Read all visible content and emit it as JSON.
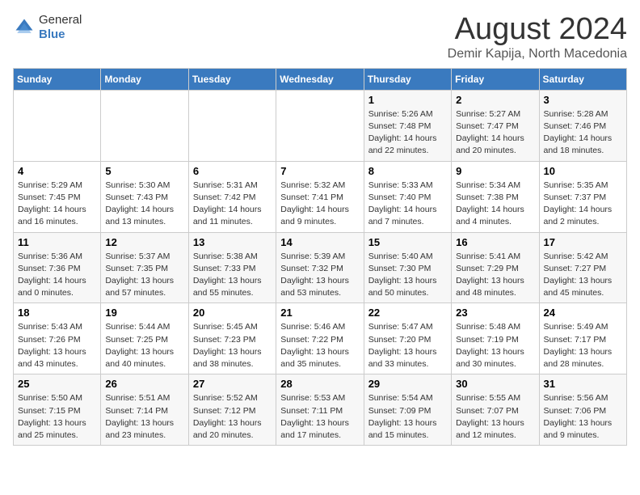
{
  "header": {
    "logo_general": "General",
    "logo_blue": "Blue",
    "title": "August 2024",
    "subtitle": "Demir Kapija, North Macedonia"
  },
  "weekdays": [
    "Sunday",
    "Monday",
    "Tuesday",
    "Wednesday",
    "Thursday",
    "Friday",
    "Saturday"
  ],
  "weeks": [
    [
      {
        "day": "",
        "sunrise": "",
        "sunset": "",
        "daylight": ""
      },
      {
        "day": "",
        "sunrise": "",
        "sunset": "",
        "daylight": ""
      },
      {
        "day": "",
        "sunrise": "",
        "sunset": "",
        "daylight": ""
      },
      {
        "day": "",
        "sunrise": "",
        "sunset": "",
        "daylight": ""
      },
      {
        "day": "1",
        "sunrise": "Sunrise: 5:26 AM",
        "sunset": "Sunset: 7:48 PM",
        "daylight": "Daylight: 14 hours and 22 minutes."
      },
      {
        "day": "2",
        "sunrise": "Sunrise: 5:27 AM",
        "sunset": "Sunset: 7:47 PM",
        "daylight": "Daylight: 14 hours and 20 minutes."
      },
      {
        "day": "3",
        "sunrise": "Sunrise: 5:28 AM",
        "sunset": "Sunset: 7:46 PM",
        "daylight": "Daylight: 14 hours and 18 minutes."
      }
    ],
    [
      {
        "day": "4",
        "sunrise": "Sunrise: 5:29 AM",
        "sunset": "Sunset: 7:45 PM",
        "daylight": "Daylight: 14 hours and 16 minutes."
      },
      {
        "day": "5",
        "sunrise": "Sunrise: 5:30 AM",
        "sunset": "Sunset: 7:43 PM",
        "daylight": "Daylight: 14 hours and 13 minutes."
      },
      {
        "day": "6",
        "sunrise": "Sunrise: 5:31 AM",
        "sunset": "Sunset: 7:42 PM",
        "daylight": "Daylight: 14 hours and 11 minutes."
      },
      {
        "day": "7",
        "sunrise": "Sunrise: 5:32 AM",
        "sunset": "Sunset: 7:41 PM",
        "daylight": "Daylight: 14 hours and 9 minutes."
      },
      {
        "day": "8",
        "sunrise": "Sunrise: 5:33 AM",
        "sunset": "Sunset: 7:40 PM",
        "daylight": "Daylight: 14 hours and 7 minutes."
      },
      {
        "day": "9",
        "sunrise": "Sunrise: 5:34 AM",
        "sunset": "Sunset: 7:38 PM",
        "daylight": "Daylight: 14 hours and 4 minutes."
      },
      {
        "day": "10",
        "sunrise": "Sunrise: 5:35 AM",
        "sunset": "Sunset: 7:37 PM",
        "daylight": "Daylight: 14 hours and 2 minutes."
      }
    ],
    [
      {
        "day": "11",
        "sunrise": "Sunrise: 5:36 AM",
        "sunset": "Sunset: 7:36 PM",
        "daylight": "Daylight: 14 hours and 0 minutes."
      },
      {
        "day": "12",
        "sunrise": "Sunrise: 5:37 AM",
        "sunset": "Sunset: 7:35 PM",
        "daylight": "Daylight: 13 hours and 57 minutes."
      },
      {
        "day": "13",
        "sunrise": "Sunrise: 5:38 AM",
        "sunset": "Sunset: 7:33 PM",
        "daylight": "Daylight: 13 hours and 55 minutes."
      },
      {
        "day": "14",
        "sunrise": "Sunrise: 5:39 AM",
        "sunset": "Sunset: 7:32 PM",
        "daylight": "Daylight: 13 hours and 53 minutes."
      },
      {
        "day": "15",
        "sunrise": "Sunrise: 5:40 AM",
        "sunset": "Sunset: 7:30 PM",
        "daylight": "Daylight: 13 hours and 50 minutes."
      },
      {
        "day": "16",
        "sunrise": "Sunrise: 5:41 AM",
        "sunset": "Sunset: 7:29 PM",
        "daylight": "Daylight: 13 hours and 48 minutes."
      },
      {
        "day": "17",
        "sunrise": "Sunrise: 5:42 AM",
        "sunset": "Sunset: 7:27 PM",
        "daylight": "Daylight: 13 hours and 45 minutes."
      }
    ],
    [
      {
        "day": "18",
        "sunrise": "Sunrise: 5:43 AM",
        "sunset": "Sunset: 7:26 PM",
        "daylight": "Daylight: 13 hours and 43 minutes."
      },
      {
        "day": "19",
        "sunrise": "Sunrise: 5:44 AM",
        "sunset": "Sunset: 7:25 PM",
        "daylight": "Daylight: 13 hours and 40 minutes."
      },
      {
        "day": "20",
        "sunrise": "Sunrise: 5:45 AM",
        "sunset": "Sunset: 7:23 PM",
        "daylight": "Daylight: 13 hours and 38 minutes."
      },
      {
        "day": "21",
        "sunrise": "Sunrise: 5:46 AM",
        "sunset": "Sunset: 7:22 PM",
        "daylight": "Daylight: 13 hours and 35 minutes."
      },
      {
        "day": "22",
        "sunrise": "Sunrise: 5:47 AM",
        "sunset": "Sunset: 7:20 PM",
        "daylight": "Daylight: 13 hours and 33 minutes."
      },
      {
        "day": "23",
        "sunrise": "Sunrise: 5:48 AM",
        "sunset": "Sunset: 7:19 PM",
        "daylight": "Daylight: 13 hours and 30 minutes."
      },
      {
        "day": "24",
        "sunrise": "Sunrise: 5:49 AM",
        "sunset": "Sunset: 7:17 PM",
        "daylight": "Daylight: 13 hours and 28 minutes."
      }
    ],
    [
      {
        "day": "25",
        "sunrise": "Sunrise: 5:50 AM",
        "sunset": "Sunset: 7:15 PM",
        "daylight": "Daylight: 13 hours and 25 minutes."
      },
      {
        "day": "26",
        "sunrise": "Sunrise: 5:51 AM",
        "sunset": "Sunset: 7:14 PM",
        "daylight": "Daylight: 13 hours and 23 minutes."
      },
      {
        "day": "27",
        "sunrise": "Sunrise: 5:52 AM",
        "sunset": "Sunset: 7:12 PM",
        "daylight": "Daylight: 13 hours and 20 minutes."
      },
      {
        "day": "28",
        "sunrise": "Sunrise: 5:53 AM",
        "sunset": "Sunset: 7:11 PM",
        "daylight": "Daylight: 13 hours and 17 minutes."
      },
      {
        "day": "29",
        "sunrise": "Sunrise: 5:54 AM",
        "sunset": "Sunset: 7:09 PM",
        "daylight": "Daylight: 13 hours and 15 minutes."
      },
      {
        "day": "30",
        "sunrise": "Sunrise: 5:55 AM",
        "sunset": "Sunset: 7:07 PM",
        "daylight": "Daylight: 13 hours and 12 minutes."
      },
      {
        "day": "31",
        "sunrise": "Sunrise: 5:56 AM",
        "sunset": "Sunset: 7:06 PM",
        "daylight": "Daylight: 13 hours and 9 minutes."
      }
    ]
  ]
}
